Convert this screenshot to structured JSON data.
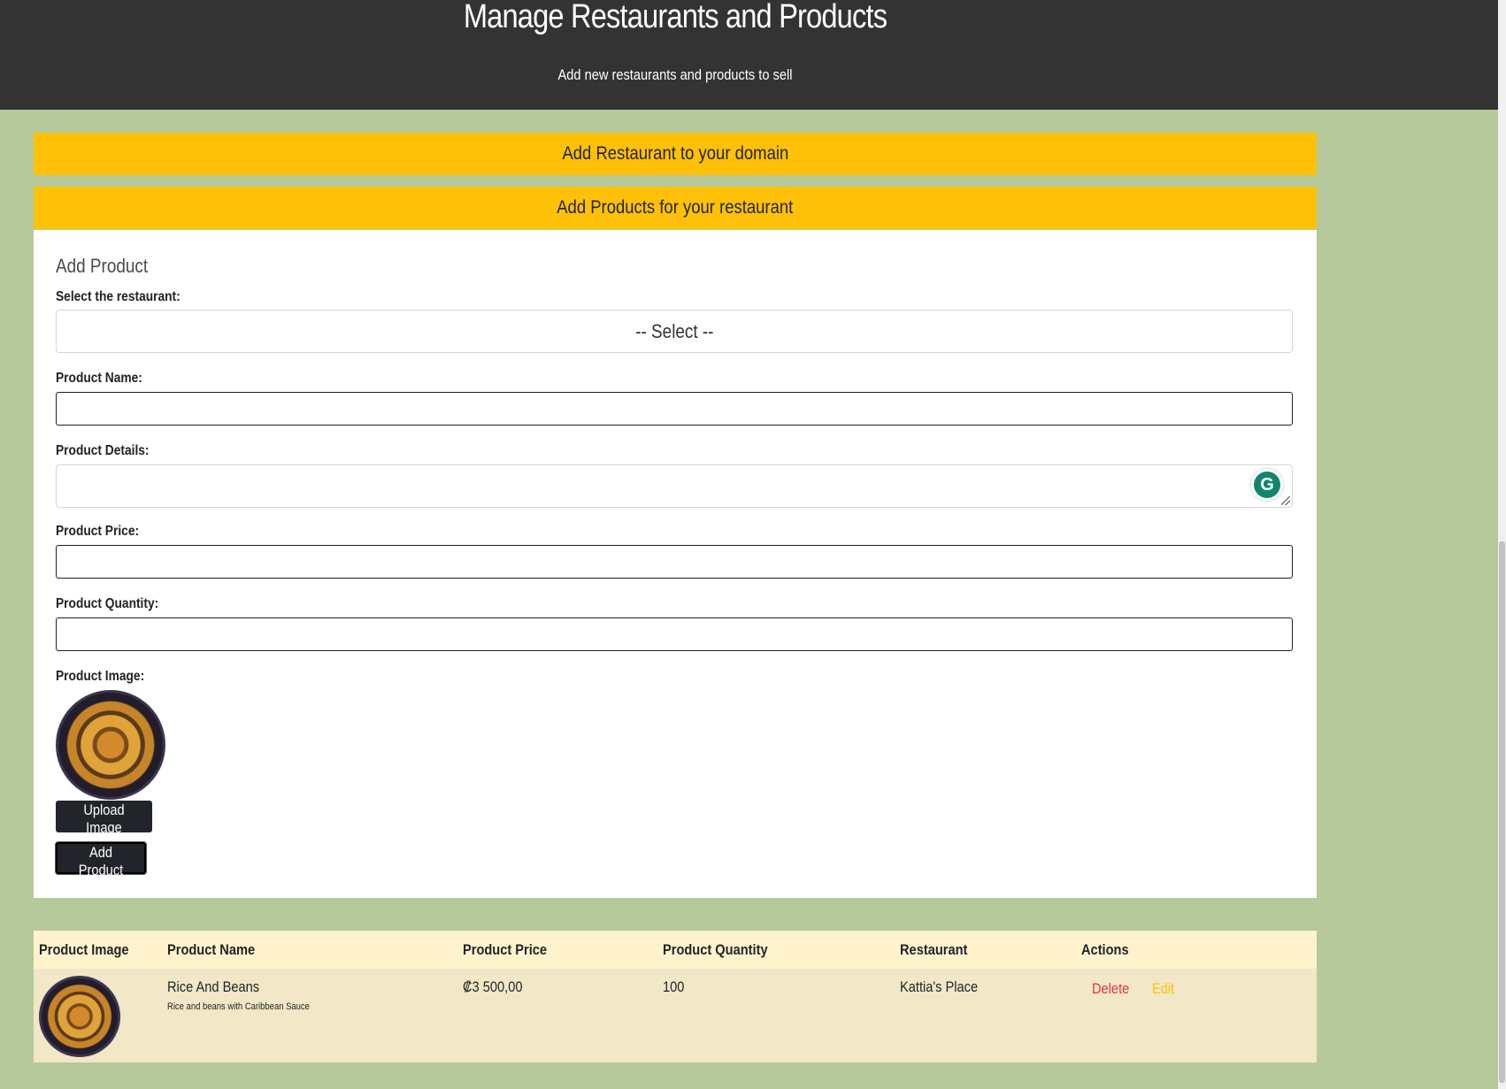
{
  "header": {
    "title": "Manage Restaurants and Products",
    "subtitle": "Add new restaurants and products to sell"
  },
  "accordion": {
    "add_restaurant_label": "Add Restaurant to your domain",
    "add_products_label": "Add Products for your restaurant"
  },
  "form": {
    "title": "Add Product",
    "restaurant_label": "Select the restaurant:",
    "restaurant_selected": "-- Select --",
    "name_label": "Product Name:",
    "name_value": "",
    "details_label": "Product Details:",
    "details_value": "",
    "price_label": "Product Price:",
    "price_value": "",
    "quantity_label": "Product Quantity:",
    "quantity_value": "",
    "image_label": "Product Image:",
    "upload_label": "Upload Image",
    "submit_label": "Add Product"
  },
  "grammarly": {
    "icon": "grammarly-icon",
    "glyph": "G"
  },
  "table": {
    "headers": [
      "Product Image",
      "Product Name",
      "Product Price",
      "Product Quantity",
      "Restaurant",
      "Actions"
    ],
    "rows": [
      {
        "name": "Rice And Beans",
        "details": "Rice and beans with Caribbean Sauce",
        "price": "₡3 500,00",
        "quantity": "100",
        "restaurant": "Kattia's Place",
        "delete_label": "Delete",
        "edit_label": "Edit"
      }
    ]
  },
  "colors": {
    "header_bg": "#333333",
    "page_bg": "#b5c99b",
    "accordion_bg": "#ffc107",
    "table_header_bg": "#fff3cd",
    "table_row_bg": "#f2e7c6",
    "delete": "#dc3545",
    "edit": "#ffc107"
  }
}
